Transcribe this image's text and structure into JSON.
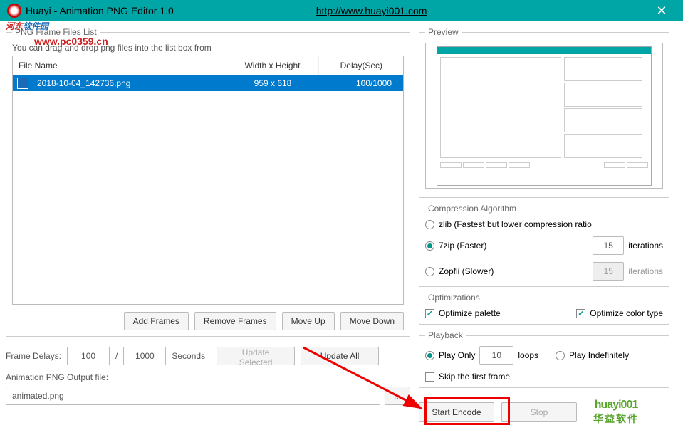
{
  "titlebar": {
    "title": "Huayi - Animation PNG Editor 1.0",
    "url": "http://www.huayi001.com"
  },
  "watermark": {
    "text_red": "河东",
    "text_blue": "软件园",
    "url": "www.pc0359.cn"
  },
  "frames_group": {
    "legend": "PNG Frame Files List",
    "hint": "You can drag and drop png files into the list box from",
    "headers": {
      "name": "File Name",
      "dim": "Width x Height",
      "delay": "Delay(Sec)"
    },
    "rows": [
      {
        "name": "2018-10-04_142736.png",
        "dim": "959 x 618",
        "delay": "100/1000"
      }
    ]
  },
  "buttons": {
    "add": "Add Frames",
    "remove": "Remove Frames",
    "up": "Move Up",
    "down": "Move Down",
    "update_sel": "Update Selected",
    "update_all": "Update All",
    "browse": "...",
    "start": "Start Encode",
    "stop": "Stop"
  },
  "frame_delays": {
    "label": "Frame Delays:",
    "num": "100",
    "slash": "/",
    "den": "1000",
    "unit": "Seconds"
  },
  "output": {
    "label": "Animation PNG Output file:",
    "value": "animated.png"
  },
  "preview": {
    "legend": "Preview"
  },
  "compression": {
    "legend": "Compression Algorithm",
    "zlib": "zlib (Fastest but lower compression ratio",
    "zip": "7zip (Faster)",
    "zip_iter": "15",
    "zopfli": "Zopfli (Slower)",
    "zopfli_iter": "15",
    "iter_label": "iterations"
  },
  "optimizations": {
    "legend": "Optimizations",
    "palette": "Optimize palette",
    "color": "Optimize color type"
  },
  "playback": {
    "legend": "Playback",
    "only": "Play Only",
    "loops_val": "10",
    "loops": "loops",
    "indef": "Play Indefinitely",
    "skip": "Skip the first frame"
  },
  "logo": {
    "en": "huayi001",
    "cn": "华益软件"
  }
}
